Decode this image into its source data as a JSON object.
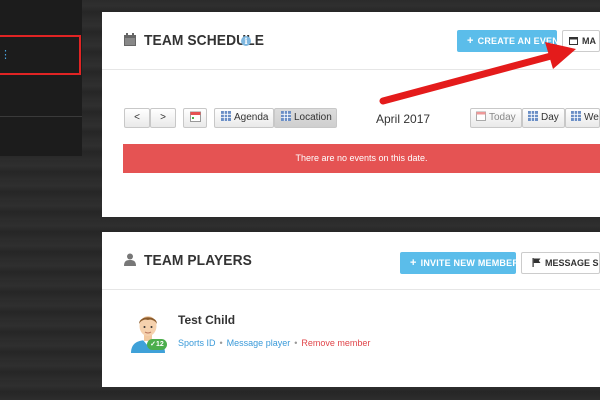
{
  "sidebar": {
    "active_item_glyph": "⋮"
  },
  "schedule": {
    "title": "TEAM SCHEDULE",
    "info_glyph": "i",
    "create_event_label": "CREATE AN EVENT",
    "manage_label": "MA",
    "prev_glyph": "<",
    "next_glyph": ">",
    "view_agenda_label": "Agenda",
    "view_location_label": "Location",
    "month_label": "April 2017",
    "today_label": "Today",
    "day_label": "Day",
    "week_label": "We",
    "empty_message": "There are no events on this date."
  },
  "players": {
    "title": "TEAM PLAYERS",
    "invite_label": "INVITE NEW MEMBERS",
    "message_label": "MESSAGE SELE",
    "items": [
      {
        "name": "Test Child",
        "badge": "12",
        "link_sports_id": "Sports ID",
        "link_message": "Message player",
        "link_remove": "Remove member"
      }
    ]
  },
  "colors": {
    "accent": "#5bbdea",
    "alert": "#e55353",
    "highlight": "#e02424",
    "link": "#3a9ad9",
    "danger": "#e0454a"
  }
}
